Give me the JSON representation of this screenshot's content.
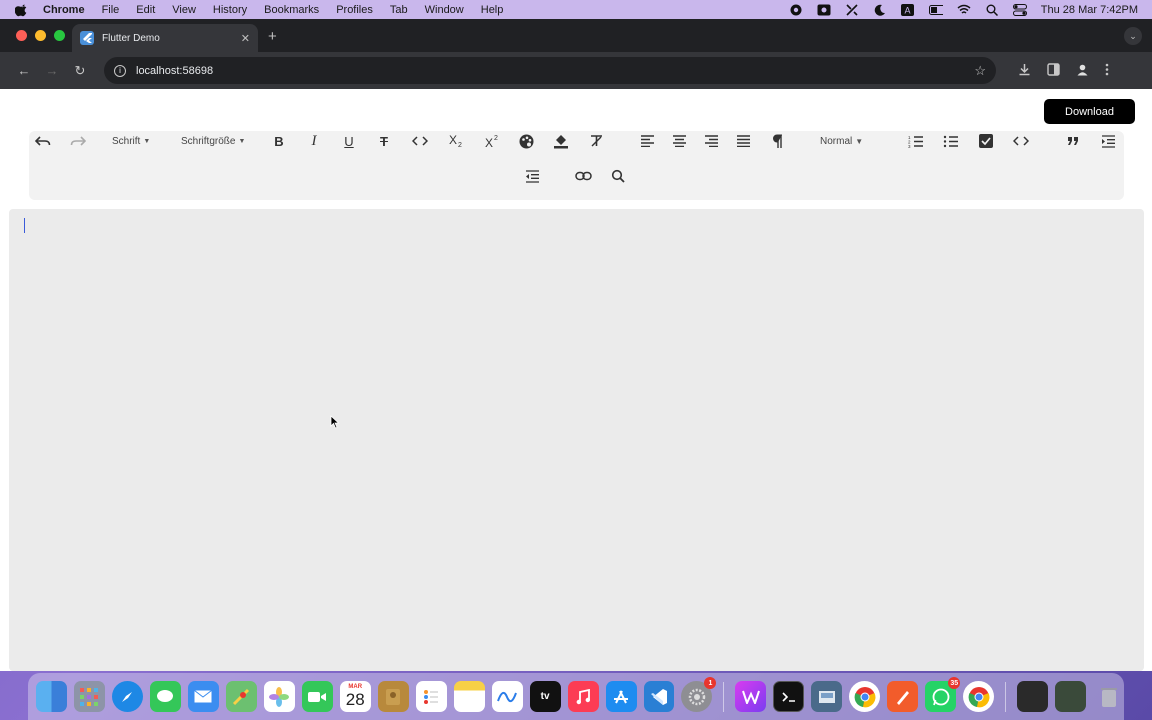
{
  "menubar": {
    "app": "Chrome",
    "items": [
      "File",
      "Edit",
      "View",
      "History",
      "Bookmarks",
      "Profiles",
      "Tab",
      "Window",
      "Help"
    ],
    "clock": "Thu 28 Mar  7:42PM"
  },
  "browser": {
    "tab_title": "Flutter Demo",
    "url": "localhost:58698"
  },
  "page": {
    "download_label": "Download",
    "font_dropdown": "Schrift",
    "size_dropdown": "Schriftgröße",
    "style_dropdown": "Normal"
  },
  "dock": {
    "calendar_month": "MAR",
    "calendar_day": "28",
    "tv_label": "tv",
    "settings_badge": "1",
    "whatsapp_badge": "35"
  }
}
